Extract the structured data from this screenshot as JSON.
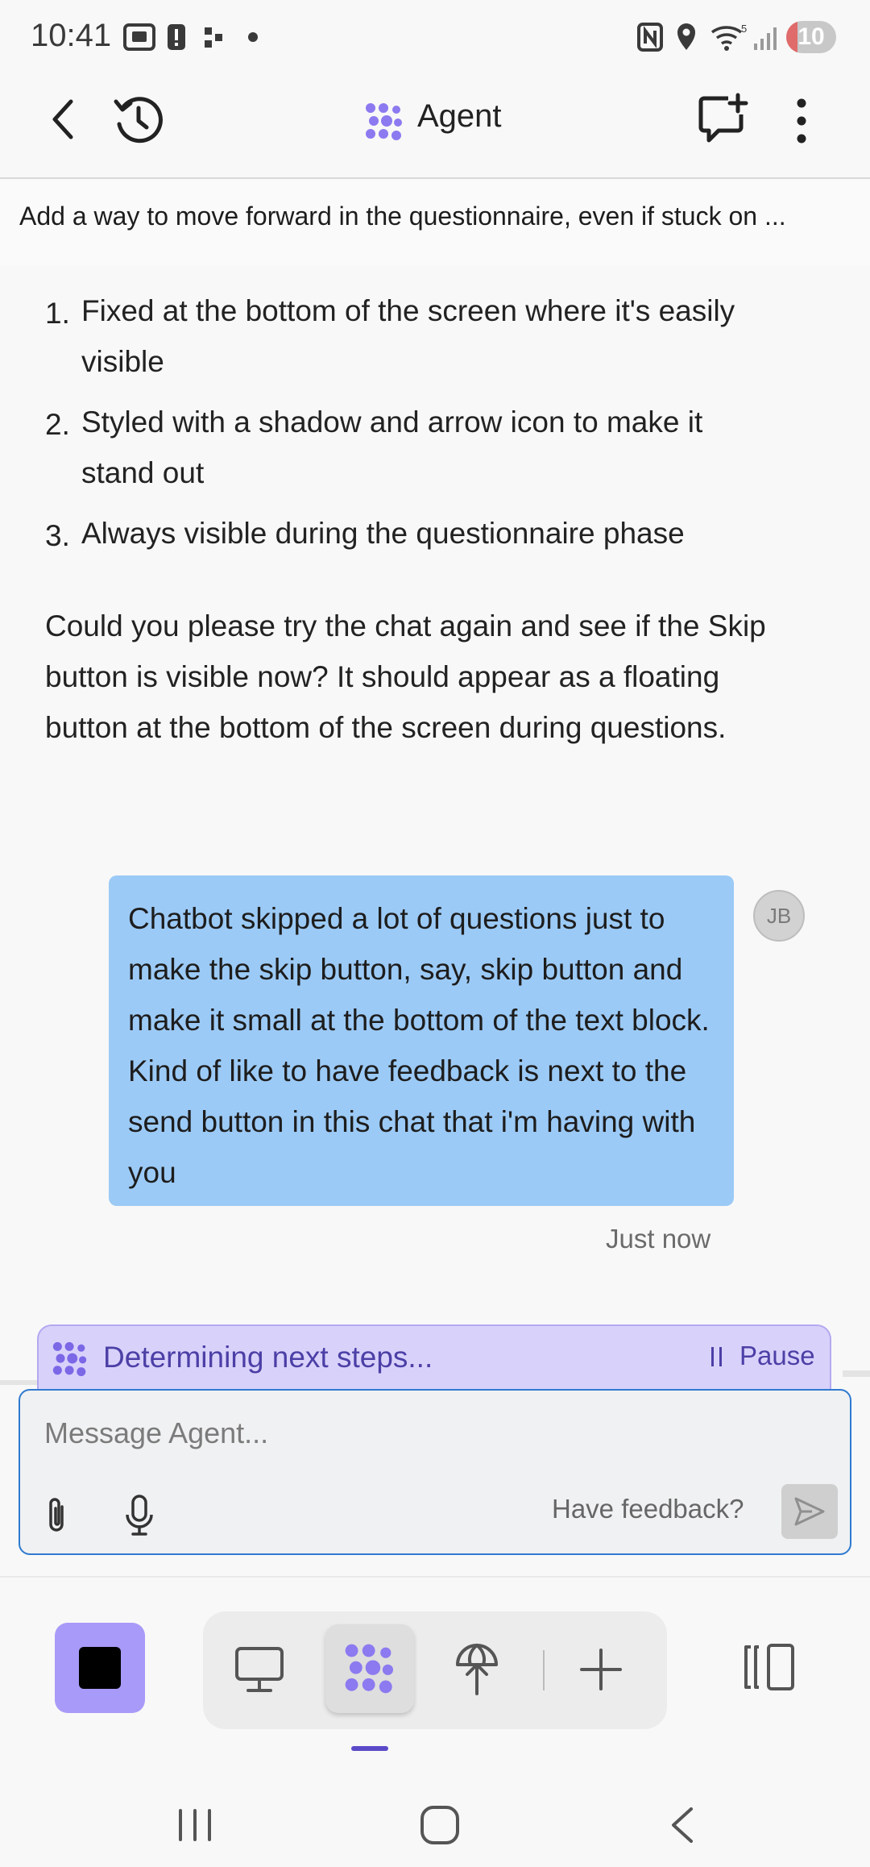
{
  "status_bar": {
    "time": "10:41",
    "battery": "10"
  },
  "header": {
    "title": "Agent"
  },
  "banner": {
    "text": "Add a way to move forward in the questionnaire, even if stuck on ..."
  },
  "conversation": {
    "list": [
      {
        "num": "1.",
        "line1": "Fixed at the bottom of the screen where it's easily",
        "line2": "visible"
      },
      {
        "num": "2.",
        "line1": "Styled with a shadow and arrow icon to make it",
        "line2": "stand out"
      },
      {
        "num": "3.",
        "line1": "Always visible during the questionnaire phase",
        "line2": ""
      }
    ],
    "paragraph": "Could you please try the chat again and see if the Skip button is visible now? It should appear as a floating button at the bottom of the screen during questions.",
    "user_message": "Chatbot skipped a lot of questions just to make the skip button, say, skip button and make it small at the bottom of the text block. Kind of like to have feedback is next to the send button in this chat that i'm having with you",
    "user_initials": "JB",
    "timestamp": "Just now"
  },
  "working": {
    "status": "Determining next steps...",
    "pause_label": "Pause"
  },
  "composer": {
    "placeholder": "Message Agent...",
    "feedback_label": "Have feedback?"
  },
  "colors": {
    "accent": "#a89af9",
    "bubble": "#9ccaf6",
    "working_bg": "#d8d2fb",
    "input_border": "#2f7ad0"
  }
}
